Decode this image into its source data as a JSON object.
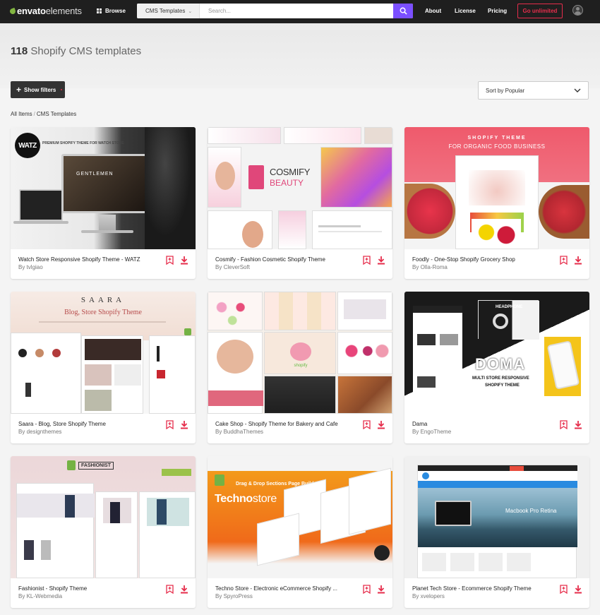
{
  "header": {
    "logo_envato": "envato",
    "logo_elements": "elements",
    "browse_label": "Browse",
    "search_category": "CMS Templates",
    "search_placeholder": "Search...",
    "nav": [
      "About",
      "License",
      "Pricing"
    ],
    "cta_label": "Go unlimited"
  },
  "page": {
    "count": "118",
    "title_rest": "Shopify CMS templates",
    "filters_label": "Show filters",
    "sort_label": "Sort by Popular",
    "breadcrumb": [
      "All Items",
      "CMS Templates"
    ]
  },
  "items": [
    {
      "title": "Watch Store Responsive Shopify Theme - WATZ",
      "author": "tvlgiao",
      "by": "By"
    },
    {
      "title": "Cosmify - Fashion Cosmetic Shopify Theme",
      "author": "CleverSoft",
      "by": "By"
    },
    {
      "title": "Foodly - One-Stop Shopify Grocery Shop",
      "author": "Olla-Roma",
      "by": "By"
    },
    {
      "title": "Saara - Blog, Store Shopify Theme",
      "author": "designthemes",
      "by": "By"
    },
    {
      "title": "Cake Shop - Shopify Theme for Bakery and Cafe",
      "author": "BuddhaThemes",
      "by": "By"
    },
    {
      "title": "Dama",
      "author": "EngoTheme",
      "by": "By"
    },
    {
      "title": "Fashionist - Shopify Theme",
      "author": "KL-Webmedia",
      "by": "By"
    },
    {
      "title": "Techno Store - Electronic eCommerce Shopify ...",
      "author": "SpyroPress",
      "by": "By"
    },
    {
      "title": "Planet Tech Store - Ecommerce Shopify Theme",
      "author": "xvelopers",
      "by": "By"
    }
  ],
  "thumb_text": {
    "watz_logo": "WATZ",
    "watz_tag": "PREMIUM SHOPIFY THEME FOR WATCH STORE",
    "watz_screen": "GENTLEMEN",
    "cosmify_brand": "COSMIFY",
    "cosmify_sub": "BEAUTY",
    "foodly_top": "SHOPIFY THEME",
    "foodly_sub": "FOR ORGANIC FOOD BUSINESS",
    "saara_name": "SAARA",
    "saara_sub": "Blog, Store Shopify Theme",
    "cake_logo": "shopify",
    "dama_brand": "DOMA",
    "dama_sub1": "MULTI STORE RESPONSIVE",
    "dama_sub2": "SHOPIFY THEME",
    "dama_head": "HEADPHONE",
    "fashion_brand": "FASHIONIST",
    "techno_tag": "Drag & Drop Sections Page Builder",
    "techno_name": "Techno",
    "techno_store": "store",
    "planet_text": "Macbook Pro Retina"
  },
  "colors": {
    "accent": "#7b4fff",
    "cta": "#e62d4b",
    "topbar": "#1f1f1f",
    "action_icon": "#e62d4b"
  }
}
